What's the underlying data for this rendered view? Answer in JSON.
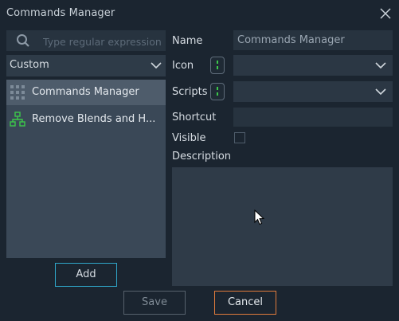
{
  "window": {
    "title": "Commands Manager"
  },
  "left": {
    "search": {
      "placeholder": "Type regular expression",
      "value": ""
    },
    "category": {
      "selected": "Custom"
    },
    "commands": [
      {
        "label": "Commands Manager",
        "icon": "grid-icon",
        "selected": true
      },
      {
        "label": "Remove Blends and H...",
        "icon": "hierarchy-icon",
        "selected": false
      }
    ],
    "add_label": "Add"
  },
  "form": {
    "name_label": "Name",
    "name_value": "Commands Manager",
    "icon_label": "Icon",
    "scripts_label": "Scripts",
    "shortcut_label": "Shortcut",
    "shortcut_value": "",
    "visible_label": "Visible",
    "visible_checked": false,
    "description_label": "Description",
    "description_value": ""
  },
  "footer": {
    "save_label": "Save",
    "cancel_label": "Cancel"
  },
  "colors": {
    "accent_blue": "#2fa6c9",
    "accent_orange": "#e07b3c",
    "icon_green": "#3cc84a"
  }
}
